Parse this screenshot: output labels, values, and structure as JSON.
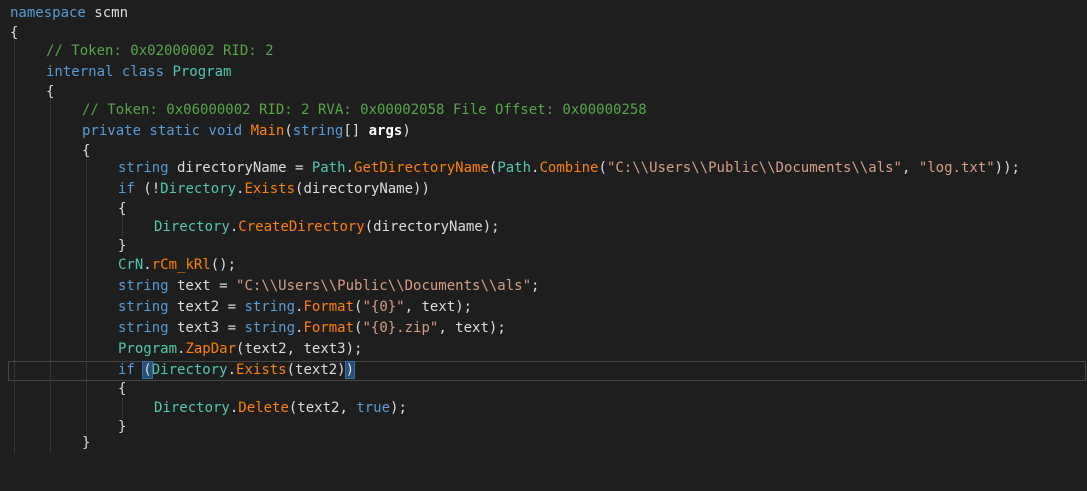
{
  "code": {
    "namespace_kw": "namespace",
    "namespace_name": "scmn",
    "open_brace": "{",
    "close_brace": "}",
    "token_comment_class": "// Token: 0x02000002 RID: 2",
    "class_modifiers": "internal class",
    "class_name": "Program",
    "token_comment_method": "// Token: 0x06000002 RID: 2 RVA: 0x00002058 File Offset: 0x00000258",
    "method_modifiers": "private static void",
    "method_name": "Main",
    "param_open": "(",
    "param_type": "string",
    "param_brackets": "[] ",
    "param_name": "args",
    "param_close": ")",
    "string_kw": "string",
    "path_type": "Path",
    "dot": ".",
    "get_dir_name_method": "GetDirectoryName",
    "combine_method": "Combine",
    "als_path_string": "\"C:\\\\Users\\\\Public\\\\Documents\\\\als\"",
    "log_string": "\"log.txt\"",
    "if_kw": "if",
    "directory_type": "Directory",
    "exists_method": "Exists",
    "create_directory_method": "CreateDirectory",
    "delete_method": "Delete",
    "crn_type": "CrN",
    "rcm_method": "rCm_kRl",
    "format_method": "Format",
    "format_string_1": "\"{0}\"",
    "format_string_2": "\"{0}.zip\"",
    "program_type": "Program",
    "zapdar_method": "ZapDar",
    "true_kw": "true",
    "var_directory_name": " directoryName = ",
    "var_text": " text = ",
    "var_text2": " text2 = ",
    "var_text3": " text3 = ",
    "l6_open": "(",
    "l6_mid": "(",
    "l6_comma": ", ",
    "l6_end": "));",
    "l7_mid": " (!",
    "l7_end": "(directoryName))",
    "l9_end": "(directoryName);",
    "l11_end": "();",
    "semicolon": ";",
    "l13_open": "(",
    "l13_end": ", text);",
    "l15_end": "(text2, text3);",
    "l16_space": " ",
    "l16_open_paren": "(",
    "l16_args": "(text2)",
    "l16_close_paren": ")",
    "l18_mid": "(text2, ",
    "l18_end": ");"
  }
}
